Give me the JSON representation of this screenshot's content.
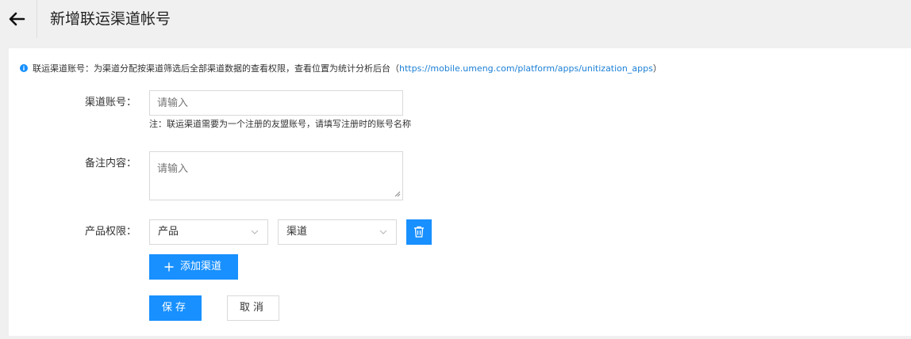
{
  "header": {
    "back_icon": "arrow-left-icon",
    "title": "新增联运渠道帐号"
  },
  "notice": {
    "icon": "info-icon",
    "text": "联运渠道账号：为渠道分配按渠道筛选后全部渠道数据的查看权限，查看位置为统计分析后台（",
    "link": "https://mobile.umeng.com/platform/apps/unitization_apps",
    "close_paren": "）"
  },
  "form": {
    "account": {
      "label": "渠道账号：",
      "placeholder": "请输入",
      "value": "",
      "hint": "注：联运渠道需要为一个注册的友盟账号，请填写注册时的账号名称"
    },
    "remark": {
      "label": "备注内容：",
      "placeholder": "请输入",
      "value": ""
    },
    "permission": {
      "label": "产品权限：",
      "product_select": "产品",
      "channel_select": "渠道",
      "delete_icon": "trash-icon"
    },
    "add_channel_label": "添加渠道",
    "add_icon": "plus-icon"
  },
  "actions": {
    "save_label": "保存",
    "cancel_label": "取消"
  },
  "colors": {
    "primary": "#1890ff",
    "link": "#1b7fd6",
    "page_bg": "#f0f0f0",
    "card_bg": "#ffffff",
    "border": "#d9d9d9"
  }
}
